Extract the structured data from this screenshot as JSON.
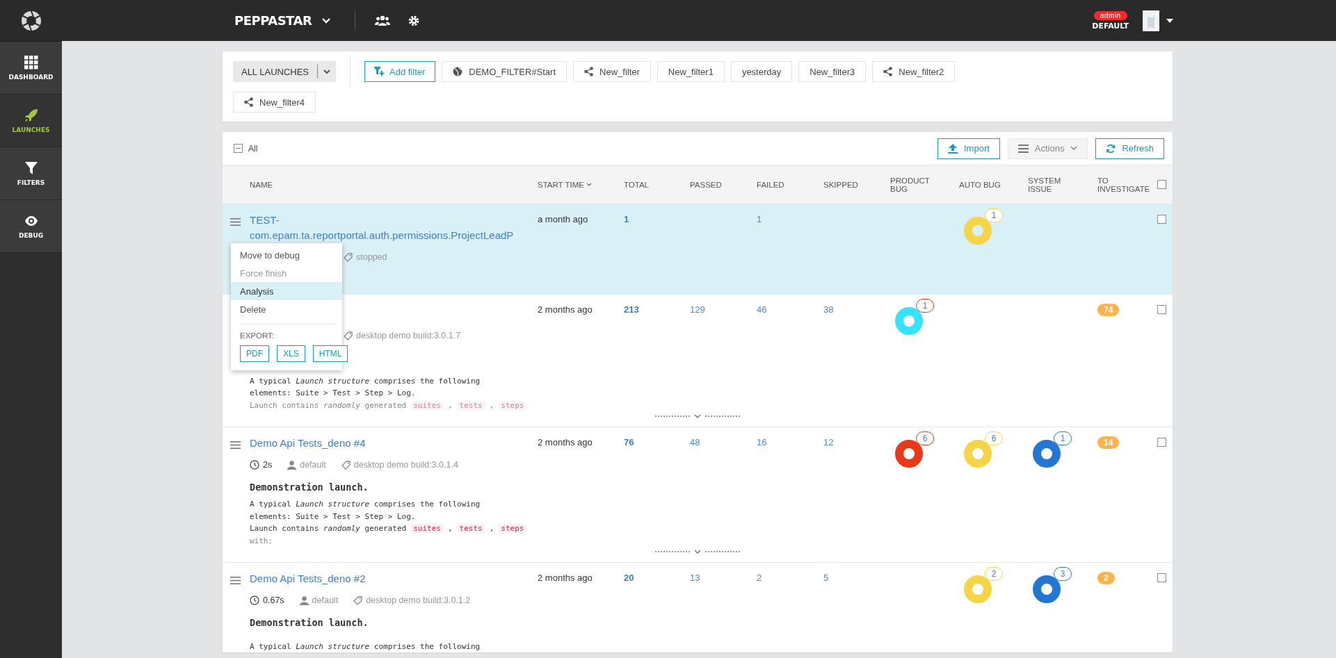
{
  "top_bar": {
    "project": "PEPPASTAR",
    "role": "admin",
    "account": "DEFAULT"
  },
  "sidebar": {
    "items": [
      {
        "label": "DASHBOARD",
        "kind": "dashboard",
        "selected": false
      },
      {
        "label": "LAUNCHES",
        "kind": "launches",
        "selected": true
      },
      {
        "label": "FILTERS",
        "kind": "filters",
        "selected": false
      },
      {
        "label": "DEBUG",
        "kind": "debug",
        "selected": false
      }
    ]
  },
  "filter_bar": {
    "launch_selector": "ALL LAUNCHES",
    "add_filter": "Add filter",
    "filters": [
      {
        "label": "DEMO_FILTER#Start",
        "kind": "public"
      },
      {
        "label": "New_filter",
        "kind": "shared"
      },
      {
        "label": "New_filter1",
        "kind": "own"
      },
      {
        "label": "yesterday",
        "kind": "own"
      },
      {
        "label": "New_filter3",
        "kind": "own"
      },
      {
        "label": "New_filter2",
        "kind": "shared"
      },
      {
        "label": "New_filter4",
        "kind": "shared"
      }
    ]
  },
  "toolbar": {
    "select_all": {
      "label": "All",
      "indeterminate": true
    },
    "buttons": [
      {
        "label": "Import",
        "kind": "import"
      },
      {
        "label": "Actions",
        "kind": "actions"
      },
      {
        "label": "Refresh",
        "kind": "refresh"
      }
    ]
  },
  "table": {
    "columns": [
      {
        "label": "NAME",
        "sorted": false
      },
      {
        "label": "START TIME",
        "sorted": true
      },
      {
        "label": "TOTAL",
        "sorted": false
      },
      {
        "label": "PASSED",
        "sorted": false
      },
      {
        "label": "FAILED",
        "sorted": false
      },
      {
        "label": "SKIPPED",
        "sorted": false
      },
      {
        "label": "PRODUCT BUG",
        "sorted": false
      },
      {
        "label": "AUTO BUG",
        "sorted": false
      },
      {
        "label": "SYSTEM ISSUE",
        "sorted": false
      },
      {
        "label": "TO INVESTIGATE",
        "sorted": false
      }
    ],
    "header_checkbox": {
      "checked": false
    },
    "rows": [
      {
        "selected": true,
        "checked": false,
        "name": "TEST-com.epam.ta.reportportal.auth.permissions.ProjectLeadP",
        "meta": [
          {
            "kind": "tag",
            "text": "stopped"
          }
        ],
        "start_time": "a month ago",
        "total": "1",
        "failed": "1",
        "defects": {
          "auto_bug": {
            "count": "1",
            "color": "#f5d547"
          }
        },
        "expand_toggle": false
      },
      {
        "selected": false,
        "checked": false,
        "meta": [
          {
            "kind": "tag",
            "text": "desktop demo build:3.0.1.7"
          }
        ],
        "start_time": "2 months ago",
        "total": "213",
        "passed": "129",
        "failed": "46",
        "skipped": "38",
        "defects": {
          "product_bug": {
            "count": "1",
            "color": "#37e3fb"
          }
        },
        "to_investigate": "74",
        "description": [
          {
            "faded": false,
            "parts": [
              {
                "kind": "text",
                "text": "A typical *Launch structure* comprises the following"
              }
            ]
          },
          {
            "faded": false,
            "parts": [
              {
                "kind": "text",
                "text": "elements: Suite > Test > Step > Log."
              }
            ]
          },
          {
            "faded": true,
            "parts": [
              {
                "kind": "text",
                "text": "Launch contains *randomly* generated"
              },
              {
                "kind": "code",
                "text": "suites"
              },
              {
                "kind": "text",
                "text": ","
              },
              {
                "kind": "code",
                "text": "tests"
              },
              {
                "kind": "text",
                "text": ","
              },
              {
                "kind": "code",
                "text": "steps"
              }
            ]
          }
        ],
        "expand_toggle": true
      },
      {
        "selected": false,
        "checked": false,
        "name": "Demo Api Tests_deno #4",
        "meta": [
          {
            "kind": "duration",
            "text": "2s"
          },
          {
            "kind": "user",
            "text": "default"
          },
          {
            "kind": "tag",
            "text": "desktop demo build:3.0.1.4"
          }
        ],
        "start_time": "2 months ago",
        "total": "76",
        "passed": "48",
        "failed": "16",
        "skipped": "12",
        "defects": {
          "product_bug": {
            "count": "6",
            "color": "#e8391a"
          },
          "auto_bug": {
            "count": "6",
            "color": "#f5d547"
          },
          "system_issue": {
            "count": "1",
            "color": "#2277d3"
          }
        },
        "to_investigate": "14",
        "heading": "Demonstration launch.",
        "description": [
          {
            "faded": false,
            "parts": [
              {
                "kind": "text",
                "text": "A typical *Launch structure* comprises the following"
              }
            ]
          },
          {
            "faded": false,
            "parts": [
              {
                "kind": "text",
                "text": "elements: Suite > Test > Step > Log."
              }
            ]
          },
          {
            "faded": false,
            "parts": [
              {
                "kind": "text",
                "text": "Launch contains *randomly* generated"
              },
              {
                "kind": "code",
                "text": "suites"
              },
              {
                "kind": "text",
                "text": ","
              },
              {
                "kind": "code",
                "text": "tests"
              },
              {
                "kind": "text",
                "text": ","
              },
              {
                "kind": "code",
                "text": "steps"
              }
            ]
          },
          {
            "faded": true,
            "parts": [
              {
                "kind": "text",
                "text": "with:"
              }
            ]
          }
        ],
        "expand_toggle": true
      },
      {
        "selected": false,
        "checked": false,
        "name": "Demo Api Tests_deno #2",
        "meta": [
          {
            "kind": "duration",
            "text": "0.67s"
          },
          {
            "kind": "user",
            "text": "default"
          },
          {
            "kind": "tag",
            "text": "desktop demo build:3.0.1.2"
          }
        ],
        "start_time": "2 months ago",
        "total": "20",
        "passed": "13",
        "failed": "2",
        "skipped": "5",
        "defects": {
          "auto_bug": {
            "count": "2",
            "color": "#f5d547"
          },
          "system_issue": {
            "count": "3",
            "color": "#2277d3"
          }
        },
        "to_investigate": "2",
        "heading": "Demonstration launch.",
        "description": [
          {
            "faded": false,
            "parts": [
              {
                "kind": "text",
                "text": "A typical *Launch structure* comprises the following"
              }
            ]
          }
        ],
        "expand_toggle": false
      }
    ]
  },
  "context_menu": {
    "items": [
      {
        "label": "Move to debug",
        "disabled": false,
        "selected": false
      },
      {
        "label": "Force finish",
        "disabled": true,
        "selected": false
      },
      {
        "label": "Analysis",
        "disabled": false,
        "selected": true
      },
      {
        "label": "Delete",
        "disabled": false,
        "selected": false
      }
    ],
    "export_label": "EXPORT:",
    "export_buttons": [
      "PDF",
      "XLS",
      "HTML"
    ]
  }
}
